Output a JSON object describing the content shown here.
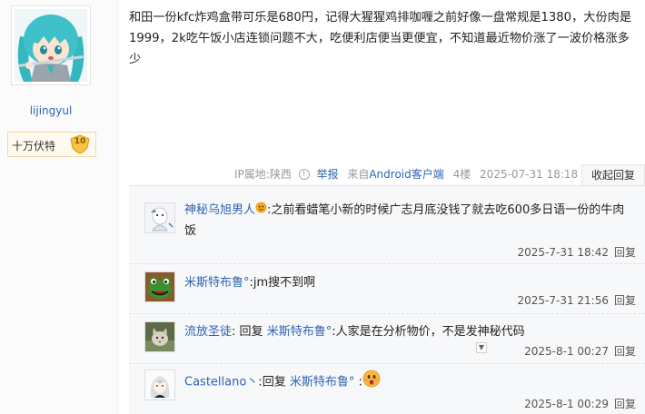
{
  "author": {
    "username": "lijingyul",
    "level_title": "十万伏特",
    "level_number": "10",
    "avatar_icon": "anime-avatar-icon"
  },
  "post": {
    "content": "和田一份kfc炸鸡盒带可乐是680円，记得大猩猩鸡排咖喱之前好像一盘常规是1380，大份肉是1999，2k吃午饭小店连锁问题不大，吃便利店便当更便宜，不知道最近物价涨了一波价格涨多少",
    "ip_location": "IP属地:陕西",
    "report_label": "举报",
    "client_prefix": "来自",
    "client_name": "Android客户端",
    "floor": "4楼",
    "datetime": "2025-07-31 18:18",
    "collapse_reply_label": "收起回复"
  },
  "replies": [
    {
      "username": "神秘乌旭男人",
      "has_emoji_after_name": true,
      "separator": ":",
      "text": "之前看蜡笔小新的时候广志月底没钱了就去吃600多日语一份的牛肉饭",
      "time": "2025-7-31 18:42",
      "reply_label": "回复",
      "avatar_icon": "white-character-avatar-icon"
    },
    {
      "username": "米斯特布鲁°",
      "separator": ":",
      "text": "jm搜不到啊",
      "time": "2025-7-31 21:56",
      "reply_label": "回复",
      "avatar_icon": "green-frog-avatar-icon"
    },
    {
      "username": "流放圣徒",
      "separator": ":",
      "reply_prefix": "回复",
      "reply_to": "米斯特布鲁°",
      "reply_separator": ":",
      "text": "人家是在分析物价，不是发神秘代码",
      "time": "2025-8-1 00:27",
      "reply_label": "回复",
      "avatar_icon": "cat-avatar-icon"
    },
    {
      "username": "Castellano丶",
      "separator": ":",
      "reply_prefix": "回复",
      "reply_to": "米斯特布鲁°",
      "reply_separator": ":",
      "text": "",
      "time": "2025-8-1 00:29",
      "reply_label": "回复",
      "avatar_icon": "silver-hair-character-avatar-icon",
      "emoji_icon": "surprised-face-emoji-icon"
    }
  ],
  "colors": {
    "link_blue": "#2d64b3",
    "sub_reply_bg": "#f7f8fa",
    "meta_gray": "#999999"
  }
}
